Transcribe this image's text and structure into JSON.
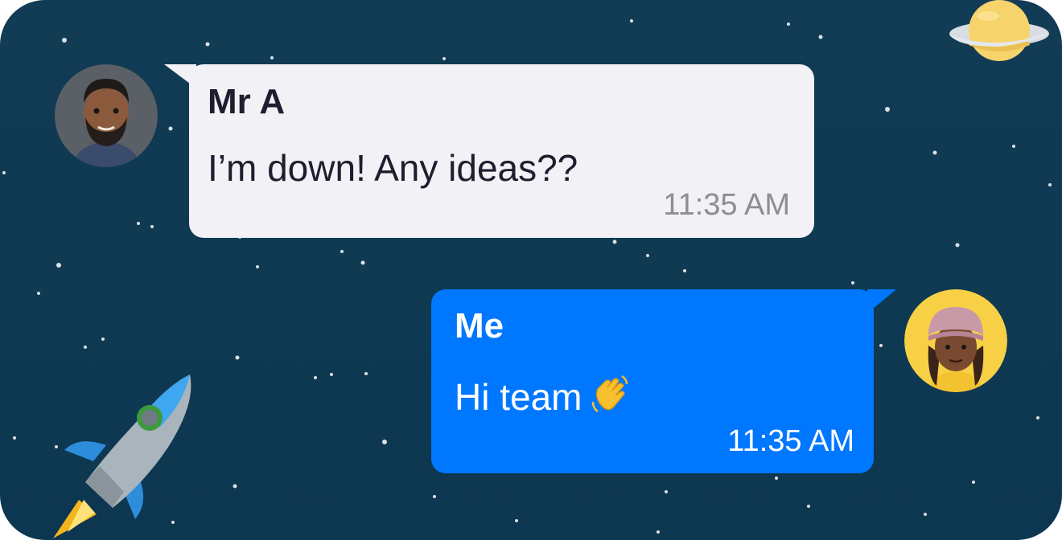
{
  "chat": {
    "messages": [
      {
        "direction": "incoming",
        "sender": "Mr A",
        "text": "I’m down! Any ideas??",
        "time": "11:35 AM",
        "bubble_color": "#f2f1f6",
        "avatar_icon": "bearded-man-avatar"
      },
      {
        "direction": "outgoing",
        "sender": "Me",
        "text": "Hi team",
        "emoji": "waving-hand-emoji",
        "time": "11:35 AM",
        "bubble_color": "#0077ff",
        "avatar_icon": "woman-beanie-avatar"
      }
    ]
  },
  "decorations": {
    "background_color": "#0f3a52",
    "icons": [
      "rocket-icon",
      "planet-icon",
      "star-field"
    ]
  }
}
